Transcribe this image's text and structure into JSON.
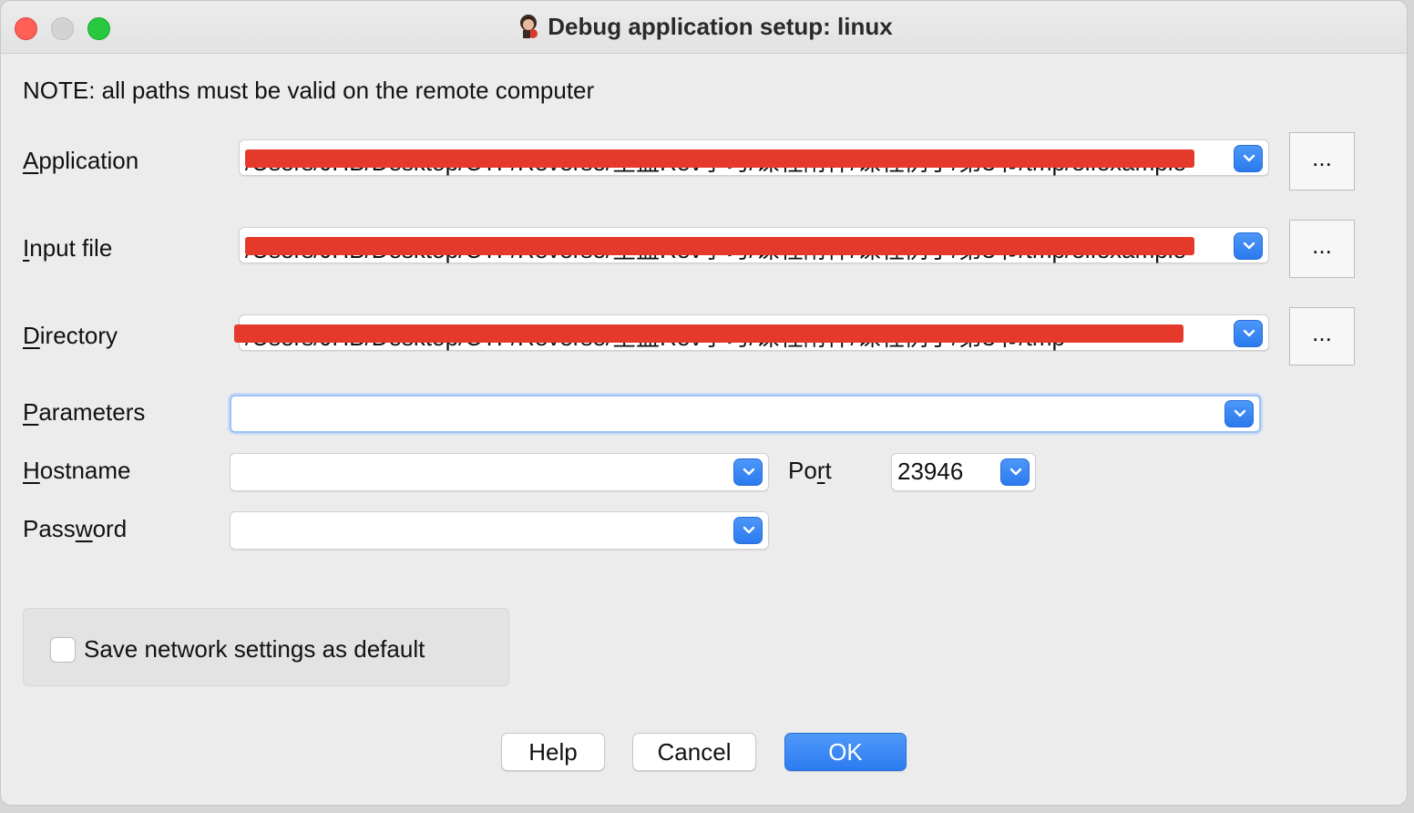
{
  "window": {
    "title": "Debug application setup: linux"
  },
  "note": "NOTE: all paths must be valid on the remote computer",
  "fields": {
    "application": {
      "label_first": "A",
      "label_rest": "pplication",
      "value": "/Users/JHB/Desktop/CTF/Reverse/星盟Rev学习/课程附件/课程例子/第3节/tmp/elfexample",
      "browse_label": "..."
    },
    "input_file": {
      "label_first": "I",
      "label_rest": "nput file",
      "value": "/Users/JHB/Desktop/CTF/Reverse/星盟Rev学习/课程附件/课程例子/第3节/tmp/elfexample",
      "browse_label": "..."
    },
    "directory": {
      "label_first": "D",
      "label_rest": "irectory",
      "value": "/Users/JHB/Desktop/CTF/Reverse/星盟Rev学习/课程附件/课程例子/第3节/tmp",
      "browse_label": "..."
    },
    "parameters": {
      "label_first": "P",
      "label_rest": "arameters",
      "value": ""
    },
    "hostname": {
      "label_first": "H",
      "label_rest": "ostname",
      "value": ""
    },
    "port": {
      "label_pre": "Po",
      "label_ul": "r",
      "label_post": "t",
      "value": "23946"
    },
    "password": {
      "label_pre": "Pass",
      "label_ul": "w",
      "label_post": "ord",
      "value": ""
    }
  },
  "save_default": {
    "label": "Save network settings as default",
    "checked": false
  },
  "buttons": {
    "help": "Help",
    "cancel": "Cancel",
    "ok": "OK"
  },
  "colors": {
    "accent": "#2c7bf0",
    "redaction": "#e53a2b",
    "close": "#fe5f57",
    "maximize": "#28c840"
  }
}
